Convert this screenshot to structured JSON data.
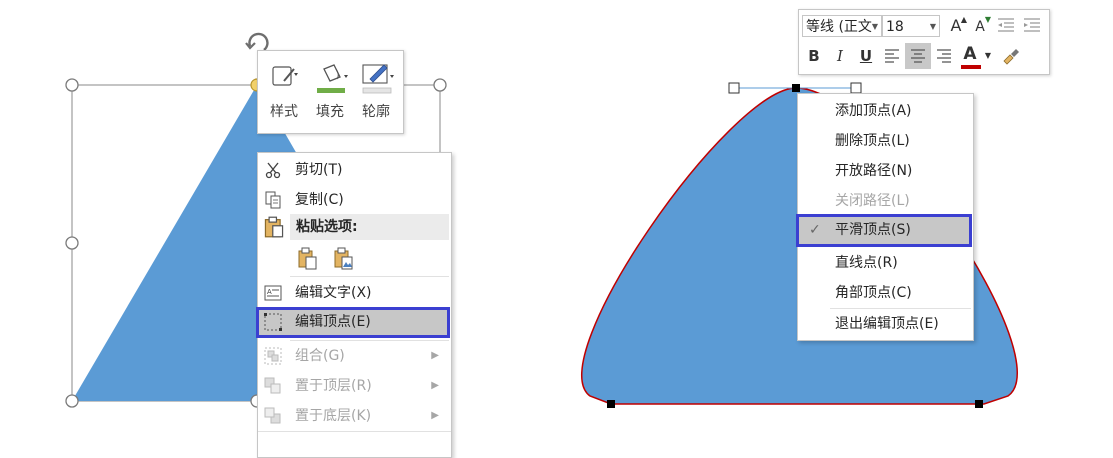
{
  "colors": {
    "shape_fill": "#5b9bd5",
    "shape_outline_red": "#c00000",
    "highlight_border": "#3b3fd1",
    "highlight_bg": "#c7c7c7",
    "font_color_bar": "#c00000"
  },
  "mini_toolbar": {
    "style_label": "样式",
    "fill_label": "填充",
    "outline_label": "轮廓",
    "icons": [
      "shape-style-icon",
      "fill-bucket-icon",
      "pen-outline-icon"
    ]
  },
  "left_menu": {
    "cut": "剪切(T)",
    "copy": "复制(C)",
    "paste_options_header": "粘贴选项:",
    "edit_text": "编辑文字(X)",
    "edit_points": "编辑顶点(E)",
    "group": "组合(G)",
    "bring_to_front": "置于顶层(R)",
    "send_to_back": "置于底层(K)"
  },
  "font_toolbar": {
    "font_name": "等线 (正文",
    "font_size": "18",
    "bold": "B",
    "italic": "I",
    "underline": "U",
    "grow_font": "A",
    "shrink_font": "A",
    "font_color_letter": "A"
  },
  "right_menu": {
    "add_point": "添加顶点(A)",
    "delete_point": "删除顶点(L)",
    "open_path": "开放路径(N)",
    "close_path": "关闭路径(L)",
    "smooth_point": "平滑顶点(S)",
    "straight_point": "直线点(R)",
    "corner_point": "角部顶点(C)",
    "exit_edit_points": "退出编辑顶点(E)",
    "checkmark": "✓"
  }
}
